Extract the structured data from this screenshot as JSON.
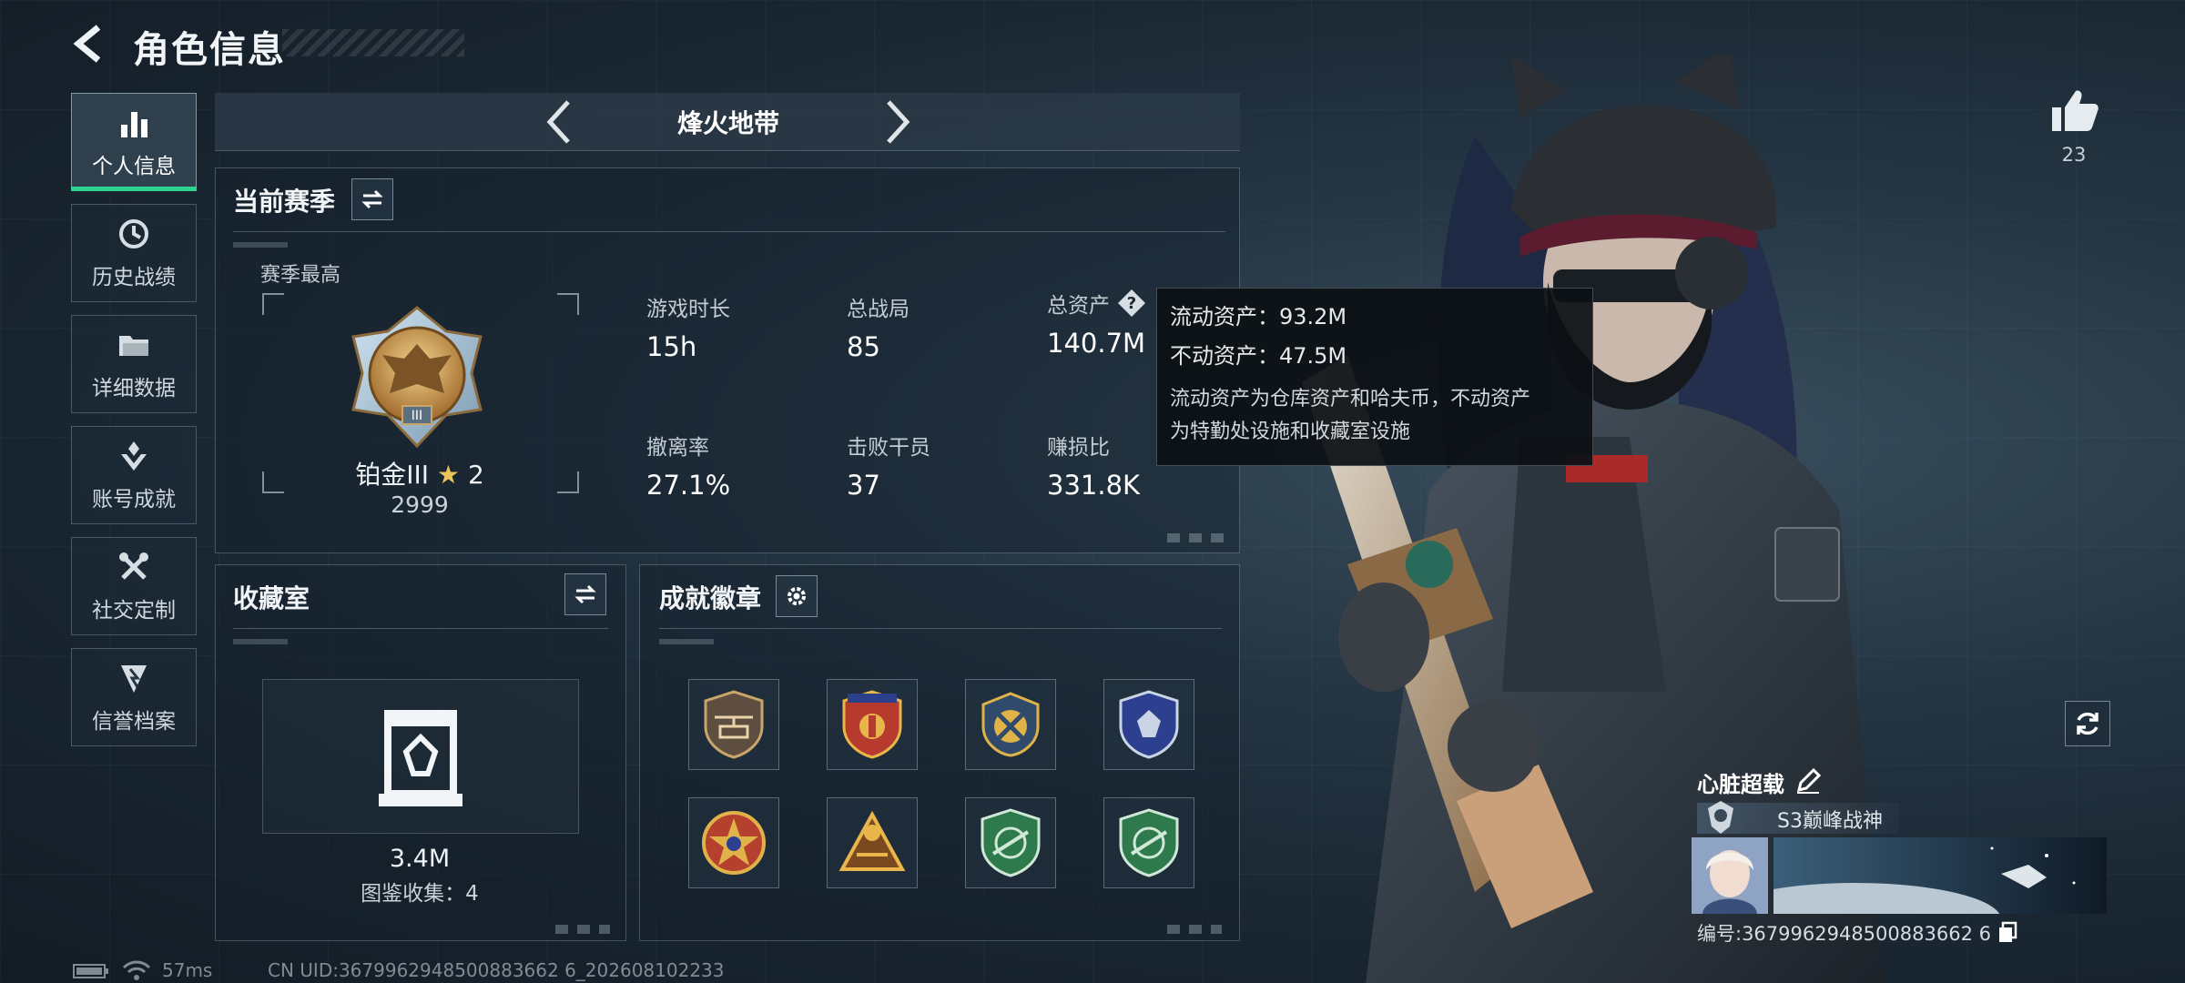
{
  "header": {
    "title": "角色信息",
    "back_icon": "back-arrow-icon"
  },
  "nav": {
    "items": [
      {
        "label": "个人信息",
        "icon": "bar-chart-icon",
        "active": true
      },
      {
        "label": "历史战绩",
        "icon": "history-icon",
        "active": false
      },
      {
        "label": "详细数据",
        "icon": "folder-icon",
        "active": false
      },
      {
        "label": "账号成就",
        "icon": "achievement-icon",
        "active": false
      },
      {
        "label": "社交定制",
        "icon": "tools-icon",
        "active": false
      },
      {
        "label": "信誉档案",
        "icon": "credit-shield-icon",
        "active": false
      }
    ]
  },
  "mode": {
    "title": "烽火地带"
  },
  "season": {
    "title": "当前赛季",
    "best_label": "赛季最高",
    "rank_name": "铂金III",
    "rank_stars": "2",
    "rank_score": "2999",
    "stats": [
      {
        "label": "游戏时长",
        "value": "15h"
      },
      {
        "label": "总战局",
        "value": "85"
      },
      {
        "label": "总资产",
        "value": "140.7M"
      },
      {
        "label": "撤离率",
        "value": "27.1%"
      },
      {
        "label": "击败干员",
        "value": "37"
      },
      {
        "label": "赚损比",
        "value": "331.8K"
      }
    ]
  },
  "tooltip": {
    "liquid": "流动资产：93.2M",
    "fixed": "不动资产：47.5M",
    "desc_line1": "流动资产为仓库资产和哈夫币，不动资产",
    "desc_line2": "为特勤处设施和收藏室设施"
  },
  "collection": {
    "title": "收藏室",
    "value": "3.4M",
    "count_text": "图鉴收集：4"
  },
  "badges": {
    "title": "成就徽章",
    "items": [
      {
        "icon": "helicopter-badge-icon"
      },
      {
        "icon": "star-shield-badge-icon"
      },
      {
        "icon": "crossed-wrench-badge-icon"
      },
      {
        "icon": "blue-shield-badge-icon"
      },
      {
        "icon": "red-star-badge-icon"
      },
      {
        "icon": "triangle-s4-badge-icon"
      },
      {
        "icon": "green-rifle-badge-icon"
      },
      {
        "icon": "green-rifle-badge-icon-2"
      }
    ]
  },
  "player": {
    "likes": "23",
    "name": "心脏超载",
    "title": "S3巅峰战神",
    "uid_text": "编号:3679962948500883662 6"
  },
  "status": {
    "ping": "57ms",
    "uid_footer": "CN UID:3679962948500883662 6_202608102233"
  },
  "colors": {
    "accent_green": "#2ed48f",
    "gold": "#e8c45a",
    "background": "#1b2833"
  }
}
